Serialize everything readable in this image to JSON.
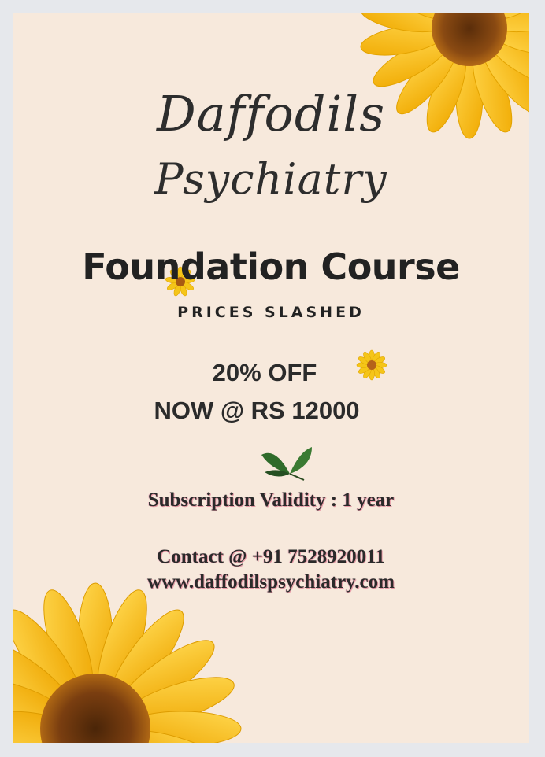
{
  "brand": {
    "line1": "Daffodils",
    "line2": "Psychiatry"
  },
  "course": {
    "title": "Foundation Course",
    "tagline": "PRICES SLASHED"
  },
  "offer": {
    "discount": "20% OFF",
    "price": "NOW @ RS 12000"
  },
  "details": {
    "validity": "Subscription Validity : 1 year",
    "contact": "Contact @ +91 7528920011",
    "website": "www.daffodilspsychiatry.com"
  },
  "colors": {
    "background": "#f7e9dc",
    "text": "#2b2b2b",
    "petal": "#f5c518",
    "petal_dark": "#e0a500",
    "center": "#8a4a12",
    "leaf": "#2f6b2a",
    "text_glow": "#e79aa6"
  },
  "icons": [
    "sunflower-icon",
    "leaves-icon"
  ]
}
